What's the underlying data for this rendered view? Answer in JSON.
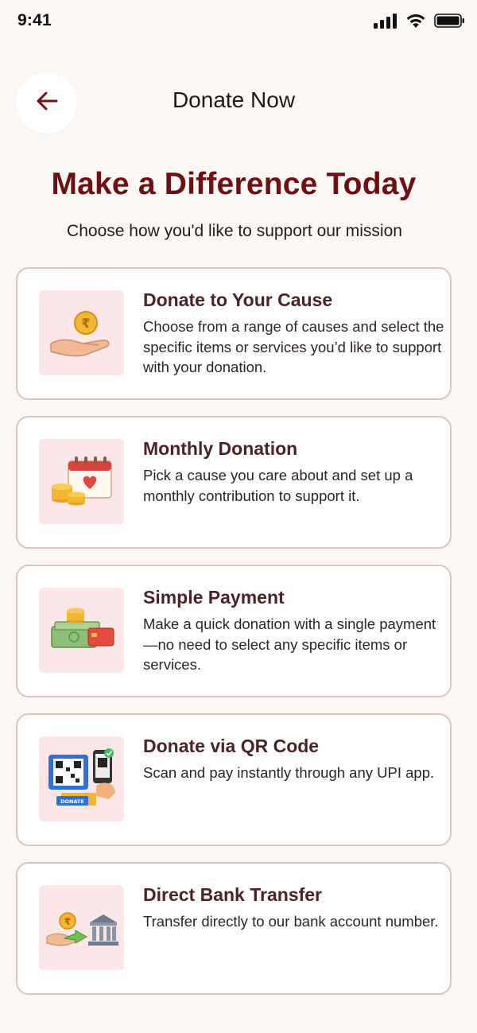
{
  "status_bar": {
    "time": "9:41"
  },
  "header": {
    "title": "Donate Now",
    "back_icon": "arrow-left-icon"
  },
  "hero": {
    "title": "Make a Difference Today",
    "subtitle": "Choose how you'd like to support our mission"
  },
  "options": [
    {
      "title": "Donate to Your Cause",
      "description": "Choose from a range of causes and select the specific items or services you’d like to support with your donation.",
      "icon": "hand-coin-icon"
    },
    {
      "title": "Monthly Donation",
      "description": "Pick a cause you care about and set up a monthly contribution to support it.",
      "icon": "calendar-coins-icon"
    },
    {
      "title": "Simple Payment",
      "description": "Make a quick donation with a single payment—no need to select any specific items or services.",
      "icon": "cash-card-icon"
    },
    {
      "title": "Donate via QR Code",
      "description": "Scan and pay instantly through any UPI app.",
      "icon": "qr-code-icon",
      "icon_badge": "DONATE"
    },
    {
      "title": "Direct Bank Transfer",
      "description": "Transfer directly to our bank account number.",
      "icon": "bank-transfer-icon"
    }
  ],
  "colors": {
    "background": "#FBF7F5",
    "accent": "#6E0F14",
    "card_border": "#DCC4C0",
    "icon_bg": "#FCE6E7"
  }
}
